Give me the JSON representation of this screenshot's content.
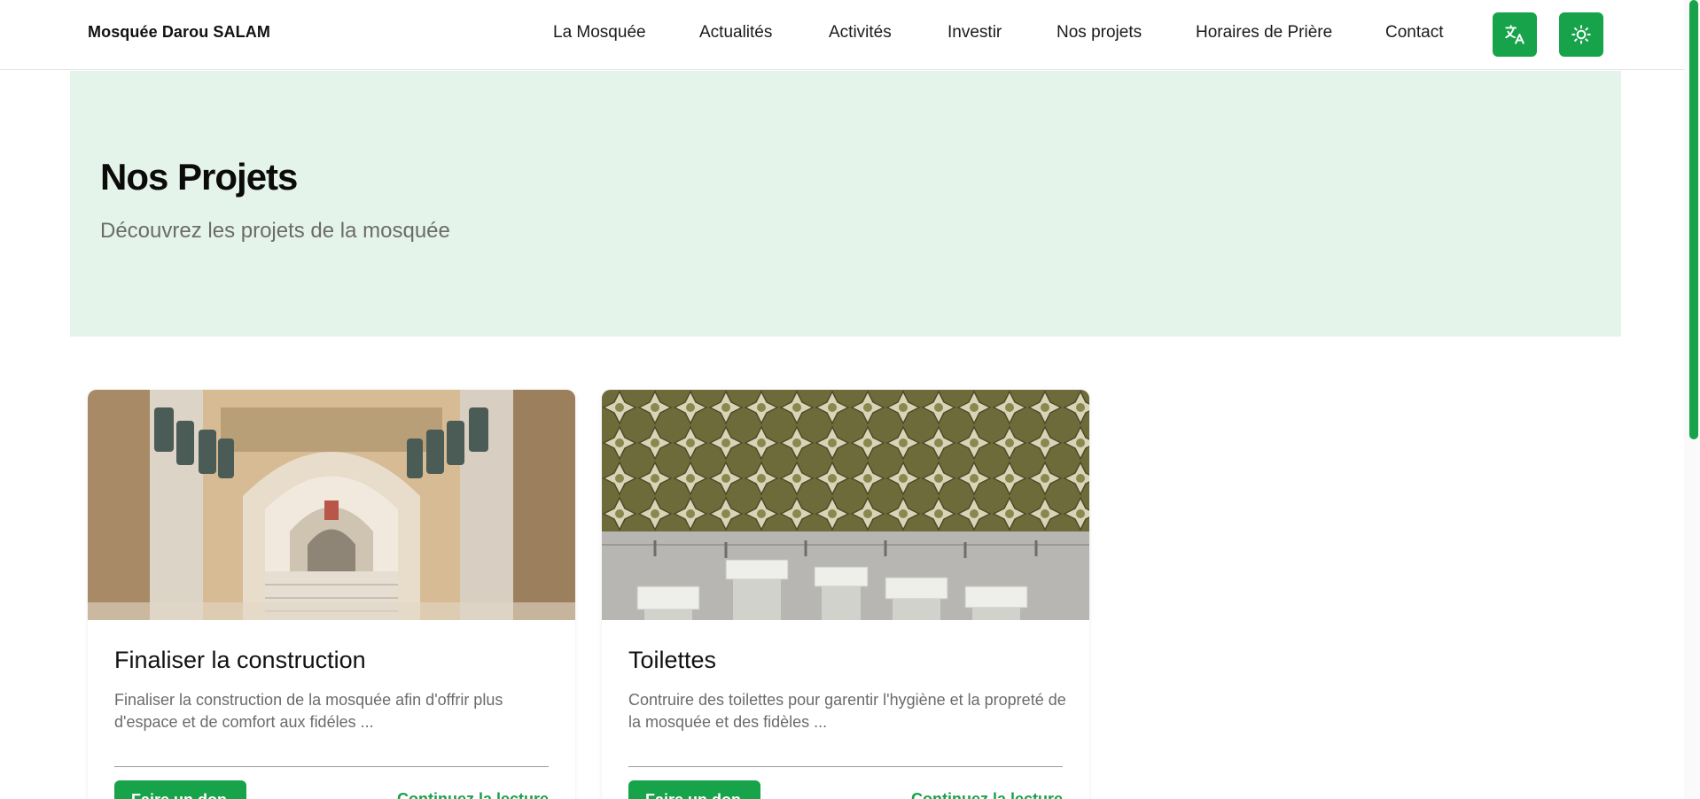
{
  "header": {
    "brand": "Mosquée Darou SALAM",
    "nav": [
      {
        "label": "La Mosquée"
      },
      {
        "label": "Actualités"
      },
      {
        "label": "Activités"
      },
      {
        "label": "Investir"
      },
      {
        "label": "Nos projets"
      },
      {
        "label": "Horaires de Prière"
      },
      {
        "label": "Contact"
      }
    ],
    "translate_icon": "translate-icon",
    "theme_icon": "sun-icon"
  },
  "hero": {
    "title": "Nos Projets",
    "subtitle": "Découvrez les projets de la mosquée"
  },
  "projects": [
    {
      "title": "Finaliser la construction",
      "description": "Finaliser la construction de la mosquée afin d'offrir plus d'espace et de comfort aux fidéles ...",
      "donate_label": "Faire un don",
      "read_more_label": "Continuez la lecture",
      "image": "mosque-arches-photo"
    },
    {
      "title": "Toilettes",
      "description": "Contruire des toilettes pour garentir l'hygiène et la propreté de la mosquée et des fidèles ...",
      "donate_label": "Faire un don",
      "read_more_label": "Continuez la lecture",
      "image": "ablution-room-photo"
    }
  ],
  "colors": {
    "accent": "#16a34a",
    "hero_bg": "#e5f4ea"
  }
}
